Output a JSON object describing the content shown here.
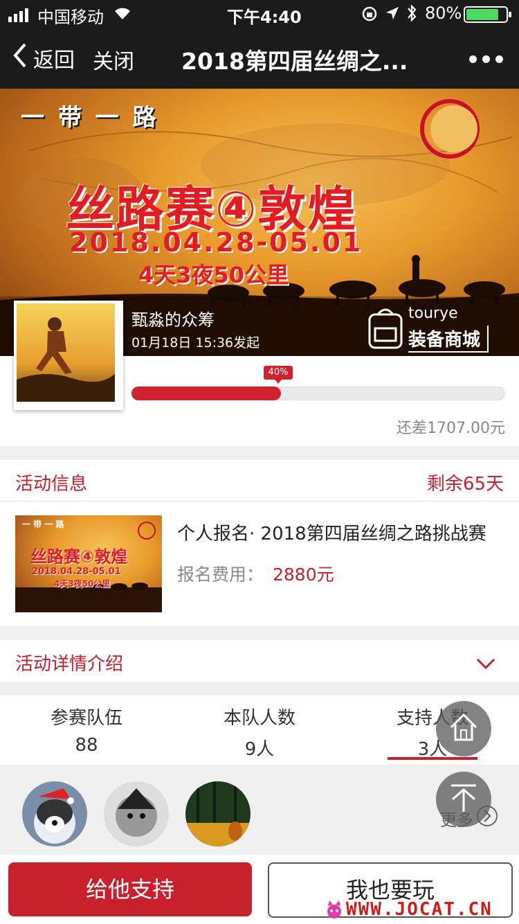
{
  "status_bar": {
    "carrier": "中国移动",
    "time": "下午4:40",
    "battery": "80%"
  },
  "nav": {
    "back_label": "返回",
    "close_label": "关闭",
    "title": "2018第四届丝绸之..."
  },
  "banner": {
    "slogan": "一 带 一 路",
    "headline": "丝路赛④敦煌",
    "date": "2018.04.28-05.01",
    "duration": "4天3夜50公里",
    "shop_brand": "tourye",
    "shop_label": "装备商城"
  },
  "raiser": {
    "name": "甄淼的众筹",
    "time": "01月18日 15:36发起"
  },
  "progress": {
    "percent_label": "40%",
    "fraction": 0.4,
    "remaining": "还差1707.00元"
  },
  "activity": {
    "section_title": "活动信息",
    "days_left": "剩余65天",
    "title": "个人报名· 2018第四届丝绸之路挑战赛",
    "fee_label": "报名费用：",
    "fee_value": "2880元",
    "thumb_slogan": "一 带 一 路",
    "thumb_headline": "丝路赛④敦煌",
    "thumb_date": "2018.04.28-05.01",
    "thumb_duration": "4天3夜50公里"
  },
  "details": {
    "title": "活动详情介绍"
  },
  "stats": [
    {
      "label": "参赛队伍",
      "value": "88"
    },
    {
      "label": "本队人数",
      "value": "9人"
    },
    {
      "label": "支持人数",
      "value": "3人"
    }
  ],
  "supporters": {
    "more_label": "更多"
  },
  "actions": {
    "support_label": "给他支持",
    "join_label": "我也要玩"
  },
  "watermark": "WWW.JOCAT.CN",
  "colors": {
    "accent": "#c8202c",
    "nav_bg": "#1b1b1b"
  }
}
